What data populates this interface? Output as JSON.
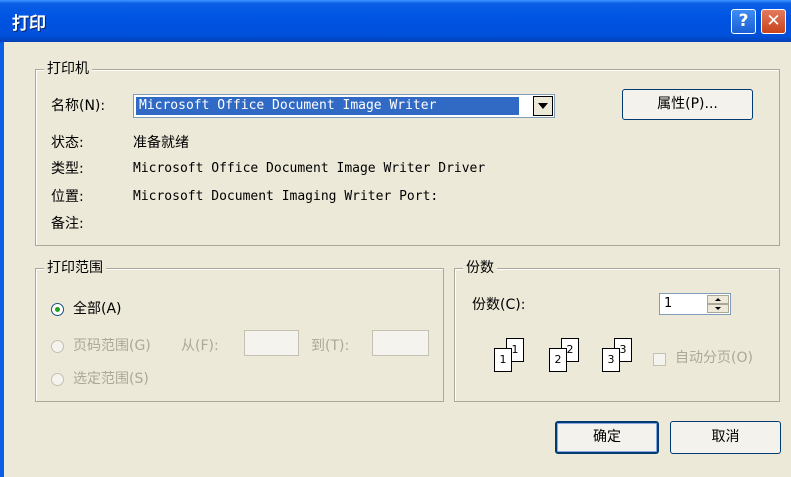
{
  "window": {
    "title": "打印"
  },
  "titlebar": {
    "help_label": "?",
    "close_label": "✕"
  },
  "printer": {
    "group_title": "打印机",
    "name_label": "名称(N):",
    "name_value": "Microsoft Office Document Image Writer",
    "properties_button": "属性(P)...",
    "status_label": "状态:",
    "status_value": "准备就绪",
    "type_label": "类型:",
    "type_value": "Microsoft Office Document Image Writer Driver",
    "where_label": "位置:",
    "where_value": "Microsoft Document Imaging Writer Port:",
    "comment_label": "备注:",
    "comment_value": ""
  },
  "range": {
    "group_title": "打印范围",
    "all_label": "全部(A)",
    "pages_label": "页码范围(G)",
    "from_label": "从(F):",
    "to_label": "到(T):",
    "from_value": "",
    "to_value": "",
    "selection_label": "选定范围(S)",
    "selected_option": "全部(A)"
  },
  "copies": {
    "group_title": "份数",
    "count_label": "份数(C):",
    "count_value": "1",
    "collate_label": "自动分页(O)",
    "collate_checked": false,
    "page_numbers": [
      "1",
      "1",
      "2",
      "2",
      "3",
      "3"
    ]
  },
  "buttons": {
    "ok": "确定",
    "cancel": "取消"
  },
  "colors": {
    "titlebar": "#0054e3",
    "face": "#ece9d8",
    "selection": "#316ac5",
    "radio_dot": "#21a121"
  }
}
